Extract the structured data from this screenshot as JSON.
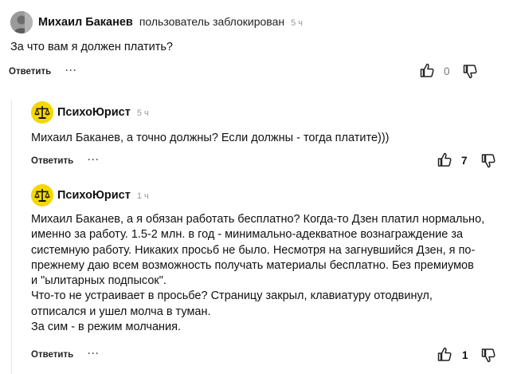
{
  "comments": [
    {
      "author": "Михаил Баканев",
      "status": "пользователь заблокирован",
      "time": "5 ч",
      "lines": [
        "За что вам я должен платить?"
      ],
      "reply_label": "Ответить",
      "more_label": "···",
      "likes": "0"
    },
    {
      "author": "ПсихоЮрист",
      "time": "5 ч",
      "lines": [
        "Михаил Баканев, а точно должны? Если должны - тогда платите)))"
      ],
      "reply_label": "Ответить",
      "more_label": "···",
      "likes": "7"
    },
    {
      "author": "ПсихоЮрист",
      "time": "1 ч",
      "lines": [
        "Михаил Баканев, а я обязан работать бесплатно? Когда-то Дзен платил нормально,",
        "именно за работу. 1.5-2 млн. в год - минимально-адекватное вознаграждение за",
        "системную работу. Никаких просьб не было. Несмотря на загнувшийся Дзен, я по-",
        "прежнему даю всем возможность получать материалы бесплатно. Без премиумов",
        "и \"ылитарных подпысок\".",
        "Что-то не устраивает в просьбе? Страницу закрыл, клавиатуру отодвинул,",
        "отписался и ушел молча в туман.",
        "За сим - в режим молчания."
      ],
      "reply_label": "Ответить",
      "more_label": "···",
      "likes": "1"
    }
  ],
  "icons": {
    "like": "thumb-up-icon",
    "dislike": "thumb-down-icon",
    "avatar_psycho": "scales-of-justice-icon"
  },
  "colors": {
    "avatar_yellow": "#f5d800",
    "text": "#111111",
    "muted": "#999999"
  }
}
